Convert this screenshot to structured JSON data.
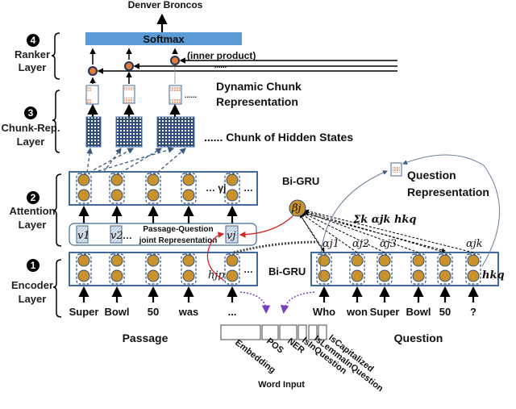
{
  "output": "Denver Broncos",
  "softmax": "Softmax",
  "inner_product": "(inner product)",
  "ellipsis_dots": "......",
  "layers": [
    {
      "number": "4",
      "name_line1": "Ranker",
      "name_line2": "Layer"
    },
    {
      "number": "3",
      "name_line1": "Chunk-Rep.",
      "name_line2": "Layer"
    },
    {
      "number": "2",
      "name_line1": "Attention",
      "name_line2": "Layer"
    },
    {
      "number": "1",
      "name_line1": "Encoder",
      "name_line2": "Layer"
    }
  ],
  "dynamic_chunk": {
    "line1": "Dynamic Chunk",
    "line2": "Representation"
  },
  "chunk_hidden": "...... Chunk of Hidden States",
  "bigru": "Bi-GRU",
  "joint": {
    "line1": "Passage-Question",
    "line2": "joint Representation",
    "v1": "v1",
    "v2": "v2",
    "vj": "vj"
  },
  "math": {
    "gamma": "… γj",
    "beta": "βj",
    "sum": "Σk αjk hkq",
    "hjp": "hjp",
    "hkq": "hkq",
    "a1": "αj1",
    "a2": "αj2",
    "a3": "αj3",
    "ak": "αjk",
    "dots": "…"
  },
  "question_rep": {
    "line1": "Question",
    "line2": "Representation"
  },
  "passage_words": [
    "Super",
    "Bowl",
    "50",
    "was",
    "..."
  ],
  "question_words": [
    "Who",
    "won",
    "Super",
    "Bowl",
    "50",
    "?"
  ],
  "passage_label": "Passage",
  "question_label": "Question",
  "word_input": {
    "title": "Word Input",
    "features": [
      "Embedding",
      "POS",
      "NER",
      "IsInQuestion",
      "IsLemmaInQuestion",
      "IsCapitalized"
    ]
  },
  "colors": {
    "softmax": "#5b9bd5",
    "cell": "#c9922a",
    "box": "#41699b",
    "red_arrow": "#d62728",
    "purple_arrow": "#7b3fbf",
    "chunk_fill": "#f4a582"
  }
}
